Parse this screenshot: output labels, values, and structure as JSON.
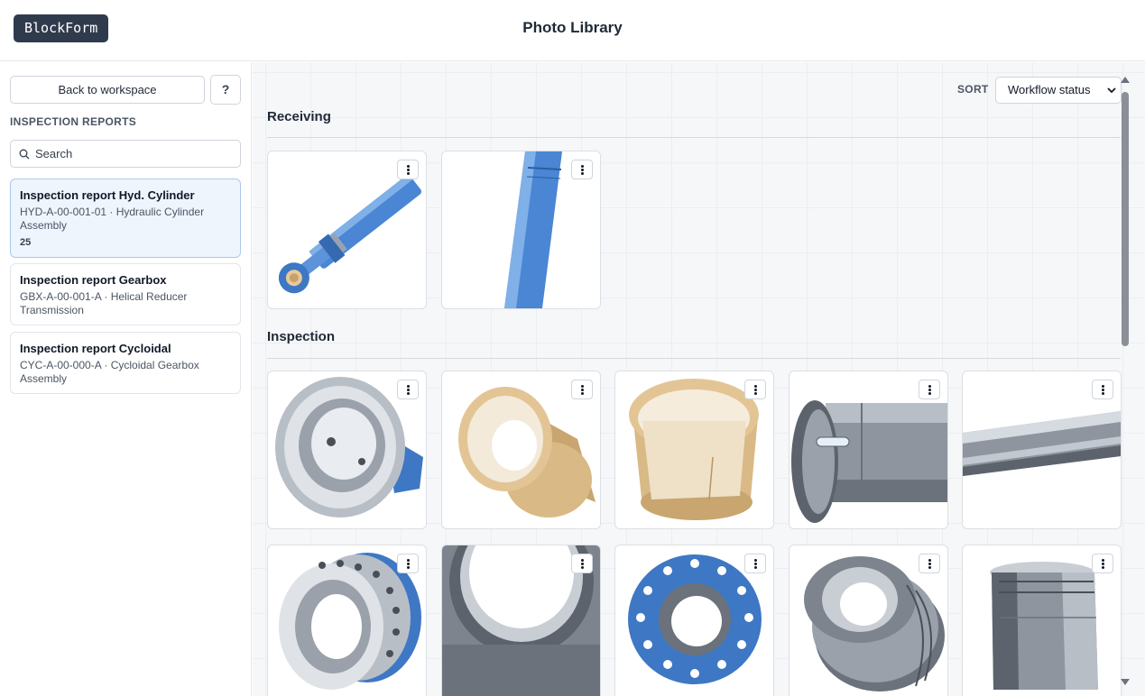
{
  "app": {
    "logo": "BlockForm",
    "title": "Photo Library"
  },
  "sidebar": {
    "back_label": "Back to workspace",
    "help_label": "?",
    "section_label": "INSPECTION REPORTS",
    "search_placeholder": "Search",
    "reports": [
      {
        "title": "Inspection report Hyd. Cylinder",
        "subtitle": "HYD-A-00-001-01 · Hydraulic Cylinder Assembly",
        "count": "25",
        "active": true
      },
      {
        "title": "Inspection report Gearbox",
        "subtitle": "GBX-A-00-001-A · Helical Reducer Transmission",
        "active": false
      },
      {
        "title": "Inspection report Cycloidal",
        "subtitle": "CYC-A-00-000-A · Cycloidal Gearbox Assembly",
        "active": false
      }
    ]
  },
  "main": {
    "sort_label": "SORT",
    "sort_value": "Workflow status",
    "groups": [
      {
        "title": "Receiving",
        "photos": [
          "cylinder-assembly",
          "cylinder-rod"
        ]
      },
      {
        "title": "Inspection",
        "photos": [
          "gland-housing",
          "bronze-bushing",
          "bronze-sleeve",
          "piston-rod-end",
          "chrome-rod",
          "flange-ring",
          "tube-end",
          "bolted-flange",
          "grooved-piston",
          "seal-sleeve"
        ]
      }
    ]
  },
  "colors": {
    "accent_blue": "#3f7fcc",
    "bronze": "#d8b784",
    "steel": "#8e959e",
    "logo_bg": "#2f3b4c"
  }
}
